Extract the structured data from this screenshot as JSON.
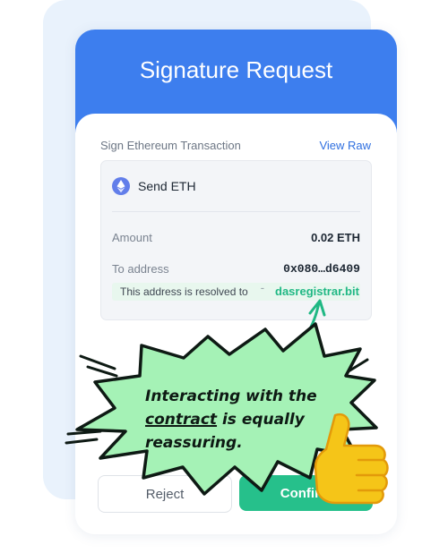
{
  "card": {
    "title": "Signature Request",
    "sign_label": "Sign Ethereum Transaction",
    "view_raw": "View Raw"
  },
  "transaction": {
    "title": "Send ETH",
    "amount_label": "Amount",
    "amount_value": "0.02 ETH",
    "to_label": "To address",
    "to_value": "0x080…d6409",
    "resolved_text": "This address is resolved to",
    "resolved_domain": "dasregistrar.bit"
  },
  "buttons": {
    "reject": "Reject",
    "confirm": "Confirm"
  },
  "callout": {
    "line1": "Interacting with the",
    "line2_underlined": "contract",
    "line2_rest": " is equally",
    "line3": "reassuring."
  },
  "colors": {
    "header_blue": "#3d7eee",
    "confirm_green": "#26c08b",
    "domain_green": "#20b884",
    "burst_fill": "#a5f2b6",
    "thumb_yellow": "#f5c518"
  },
  "icons": [
    "eth-icon",
    "resolve-icon",
    "arrow-icon",
    "thumbs-up-icon"
  ]
}
